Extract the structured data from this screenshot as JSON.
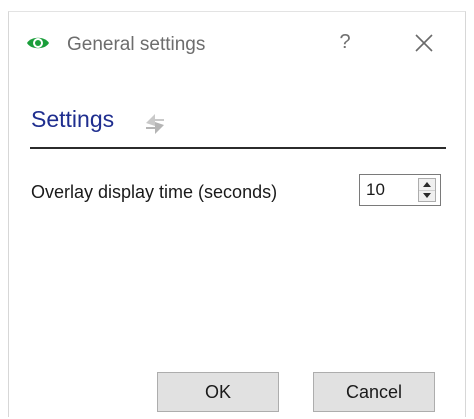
{
  "window": {
    "title": "General settings",
    "help_symbol": "?",
    "close_symbol": "×",
    "app_icon": "eye-icon"
  },
  "section": {
    "title": "Settings",
    "refresh_icon": "refresh-icon"
  },
  "overlay_time": {
    "label": "Overlay display time (seconds)",
    "value": "10"
  },
  "buttons": {
    "ok": "OK",
    "cancel": "Cancel"
  },
  "colors": {
    "eye_icon": "#1a9e3a",
    "section_title": "#1f2e8f",
    "title_text": "#6d6d6d"
  }
}
